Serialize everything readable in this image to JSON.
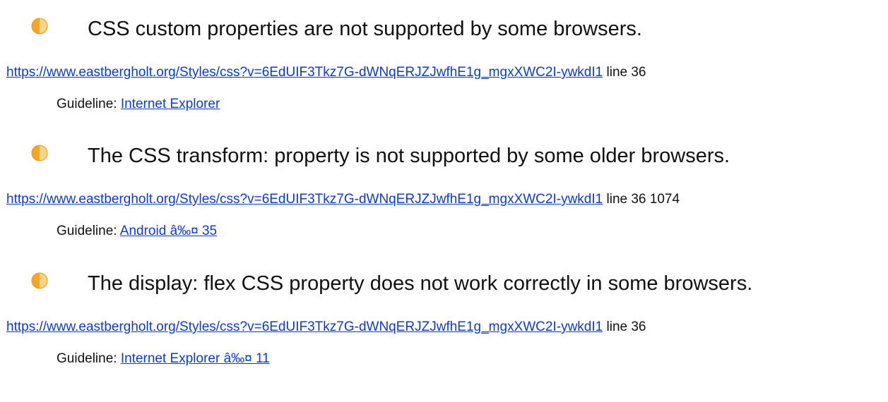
{
  "colors": {
    "warning_icon": "#f5a623",
    "link": "#0b3bd6",
    "text": "#111111"
  },
  "issues": [
    {
      "icon": "half-circle-warning-icon",
      "title": "CSS custom properties are not supported by some browsers.",
      "url": "https://www.eastbergholt.org/Styles/css?v=6EdUIF3Tkz7G-dWNqERJZJwfhE1g_mgxXWC2I-ywkdI1",
      "location": " line 36",
      "guideline_label": "Guideline: ",
      "guideline_link": "Internet Explorer"
    },
    {
      "icon": "half-circle-warning-icon",
      "title": "The CSS transform: property is not supported by some older browsers.",
      "url": "https://www.eastbergholt.org/Styles/css?v=6EdUIF3Tkz7G-dWNqERJZJwfhE1g_mgxXWC2I-ywkdI1",
      "location": " line 36 1074",
      "guideline_label": "Guideline: ",
      "guideline_link": "Android â‰¤ 35"
    },
    {
      "icon": "half-circle-warning-icon",
      "title": "The display: flex CSS property does not work correctly in some browsers.",
      "url": "https://www.eastbergholt.org/Styles/css?v=6EdUIF3Tkz7G-dWNqERJZJwfhE1g_mgxXWC2I-ywkdI1",
      "location": " line 36",
      "guideline_label": "Guideline: ",
      "guideline_link": "Internet Explorer â‰¤ 11"
    }
  ]
}
